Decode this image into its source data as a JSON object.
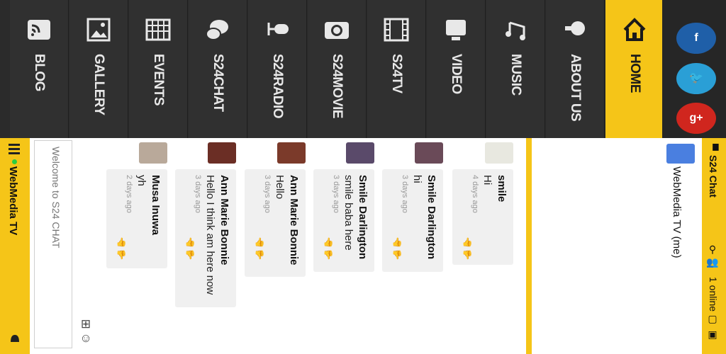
{
  "nav": {
    "items": [
      {
        "label": "BLOG",
        "icon": "blog-icon"
      },
      {
        "label": "GALLERY",
        "icon": "gallery-icon"
      },
      {
        "label": "EVENTS",
        "icon": "events-icon"
      },
      {
        "label": "S24CHAT",
        "icon": "chat-icon"
      },
      {
        "label": "S24RADIO",
        "icon": "radio-icon"
      },
      {
        "label": "S24MOVIE",
        "icon": "camera-icon"
      },
      {
        "label": "S24TV",
        "icon": "film-icon"
      },
      {
        "label": "VIDEO",
        "icon": "video-icon"
      },
      {
        "label": "MUSIC",
        "icon": "music-icon"
      },
      {
        "label": "ABOUT US",
        "icon": "lightbulb-icon"
      },
      {
        "label": "HOME",
        "icon": "home-icon"
      }
    ],
    "active": "HOME",
    "social": [
      {
        "name": "facebook",
        "glyph": "f",
        "color": "#1f5fa8"
      },
      {
        "name": "twitter",
        "glyph": "🐦",
        "color": "#2a9fd6"
      },
      {
        "name": "google-plus",
        "glyph": "g+",
        "color": "#d0261e"
      }
    ]
  },
  "chat": {
    "room_title": "WebMedia TV",
    "input_placeholder": "Welcome to S24 CHAT",
    "panel_title": "S24 Chat",
    "online_count": "1 online",
    "current_user": "WebMedia TV (me)",
    "messages": [
      {
        "name": "smile",
        "text": "Hi",
        "time": "4 days ago",
        "avatar_color": "#e8e8e0"
      },
      {
        "name": "Smile Darlington",
        "text": "hi",
        "time": "3 days ago",
        "avatar_color": "#6a4a58"
      },
      {
        "name": "Smile Darlington",
        "text": "smile baba here",
        "time": "3 days ago",
        "avatar_color": "#5a4a6a"
      },
      {
        "name": "Ann Marie Bonnie",
        "text": "Hello",
        "time": "3 days ago",
        "avatar_color": "#7b3a2a"
      },
      {
        "name": "Ann Marie Bonnie",
        "text": "Hello I think am here now",
        "time": "3 days ago",
        "avatar_color": "#6b2e25"
      },
      {
        "name": "Musa Inuwa",
        "text": "yh",
        "time": "2 days ago",
        "avatar_color": "#b9a99a"
      }
    ]
  },
  "colors": {
    "accent": "#f5c518",
    "nav_bg": "#303030"
  }
}
